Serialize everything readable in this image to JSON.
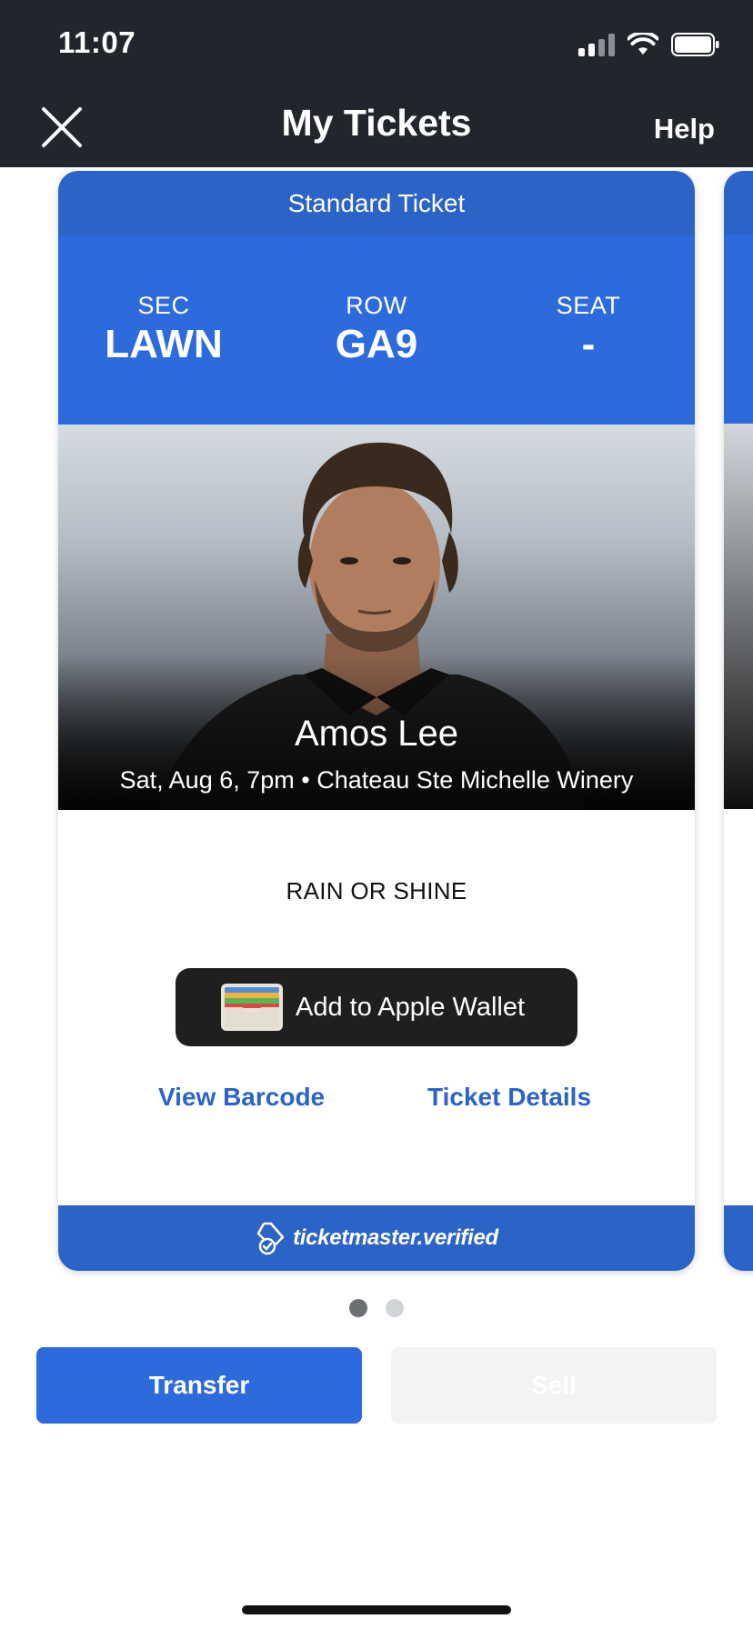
{
  "status_bar": {
    "time": "11:07"
  },
  "header": {
    "title": "My Tickets",
    "help_label": "Help"
  },
  "ticket": {
    "type": "Standard Ticket",
    "section_label": "SEC",
    "section_value": "LAWN",
    "row_label": "ROW",
    "row_value": "GA9",
    "seat_label": "SEAT",
    "seat_value": "-",
    "artist": "Amos Lee",
    "event_line": "Sat, Aug 6, 7pm • Chateau Ste Michelle Winery",
    "notice": "RAIN OR SHINE",
    "wallet_button": "Add to Apple Wallet",
    "view_barcode": "View Barcode",
    "ticket_details": "Ticket Details",
    "verified_text": "ticketmaster.verified"
  },
  "pager": {
    "count": 2,
    "active_index": 0
  },
  "actions": {
    "transfer": "Transfer",
    "sell": "Sell"
  },
  "colors": {
    "header_bg": "#22262c",
    "ticket_blue": "#2d6bdc",
    "link_blue": "#2b63c6",
    "wallet_bg": "#1f1f1f"
  }
}
